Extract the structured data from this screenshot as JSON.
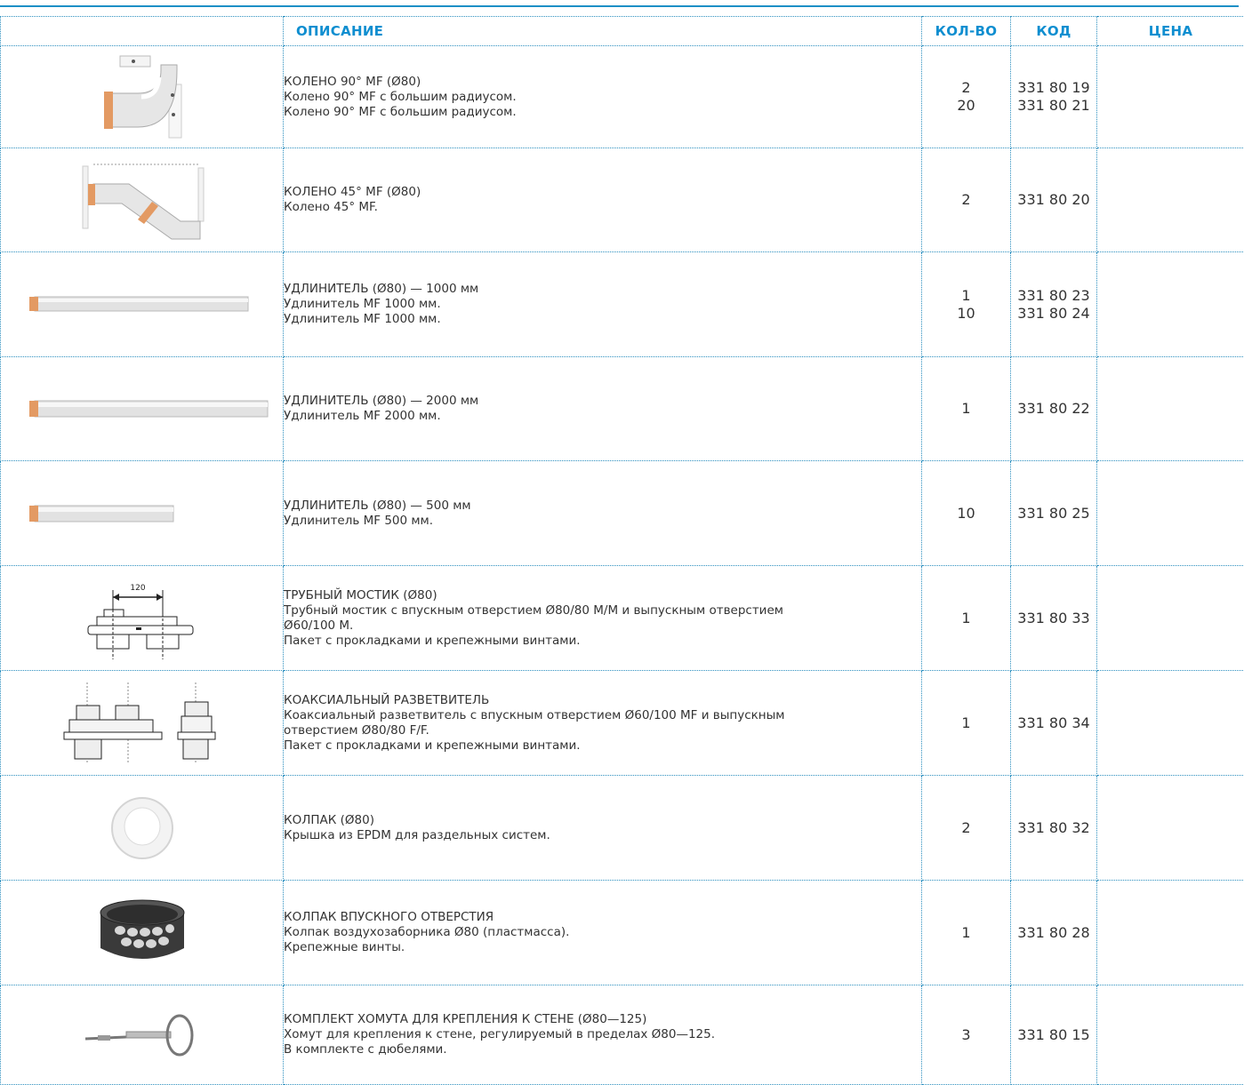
{
  "header": {
    "image_col": "",
    "description": "ОПИСАНИЕ",
    "qty": "КОЛ-ВО",
    "code": "КОД",
    "price": "ЦЕНА"
  },
  "colors": {
    "accent": "#0e8ed0",
    "rule": "#1d8fc6",
    "copper": "#e39a63"
  },
  "rows": [
    {
      "icon": "elbow-90-icon",
      "title": "КОЛЕНО 90° MF (Ø80)",
      "lines": [
        "Колено 90° MF с большим радиусом.",
        "Колено 90° MF с большим радиусом."
      ],
      "qty": [
        "2",
        "20"
      ],
      "code": [
        "331 80 19",
        "331 80 21"
      ]
    },
    {
      "icon": "elbow-45-icon",
      "title": "КОЛЕНО 45° MF (Ø80)",
      "lines": [
        "Колено 45° MF."
      ],
      "qty": [
        "2"
      ],
      "code": [
        "331 80 20"
      ]
    },
    {
      "icon": "pipe-1000-icon",
      "title": "УДЛИНИТЕЛЬ (Ø80) — 1000 мм",
      "lines": [
        "Удлинитель MF 1000 мм.",
        "Удлинитель MF 1000 мм."
      ],
      "qty": [
        "1",
        "10"
      ],
      "code": [
        "331 80 23",
        "331 80 24"
      ]
    },
    {
      "icon": "pipe-2000-icon",
      "title": "УДЛИНИТЕЛЬ (Ø80) — 2000 мм",
      "lines": [
        "Удлинитель MF 2000 мм."
      ],
      "qty": [
        "1"
      ],
      "code": [
        "331 80 22"
      ]
    },
    {
      "icon": "pipe-500-icon",
      "title": "УДЛИНИТЕЛЬ (Ø80) — 500 мм",
      "lines": [
        "Удлинитель MF 500 мм."
      ],
      "qty": [
        "10"
      ],
      "code": [
        "331 80 25"
      ]
    },
    {
      "icon": "pipe-bridge-icon",
      "title": "ТРУБНЫЙ МОСТИК (Ø80)",
      "dimension_label": "120",
      "lines": [
        "Трубный мостик с впускным отверстием Ø80/80 M/M и выпускным отверстием",
        "Ø60/100 M.",
        "Пакет с прокладками и крепежными винтами."
      ],
      "qty": [
        "1"
      ],
      "code": [
        "331 80 33"
      ]
    },
    {
      "icon": "coaxial-splitter-icon",
      "title": "КОАКСИАЛЬНЫЙ РАЗВЕТВИТЕЛЬ",
      "lines": [
        "Коаксиальный разветвитель с впускным отверстием Ø60/100 MF и выпускным",
        "отверстием Ø80/80 F/F.",
        "Пакет с прокладками и крепежными винтами."
      ],
      "qty": [
        "1"
      ],
      "code": [
        "331 80 34"
      ]
    },
    {
      "icon": "cap-ring-icon",
      "title": "КОЛПАК (Ø80)",
      "lines": [
        "Крышка из EPDM для раздельных систем."
      ],
      "qty": [
        "2"
      ],
      "code": [
        "331 80 32"
      ]
    },
    {
      "icon": "inlet-cap-icon",
      "title": "КОЛПАК ВПУСКНОГО ОТВЕРСТИЯ",
      "lines": [
        "Колпак воздухозаборника Ø80 (пластмасса).",
        "Крепежные винты."
      ],
      "qty": [
        "1"
      ],
      "code": [
        "331 80 28"
      ]
    },
    {
      "icon": "wall-clamp-icon",
      "title": "КОМПЛЕКТ ХОМУТА ДЛЯ КРЕПЛЕНИЯ К СТЕНЕ (Ø80—125)",
      "lines": [
        "Хомут для крепления к стене, регулируемый в пределах Ø80—125.",
        "В комплекте с дюбелями."
      ],
      "qty": [
        "3"
      ],
      "code": [
        "331 80 15"
      ]
    }
  ]
}
